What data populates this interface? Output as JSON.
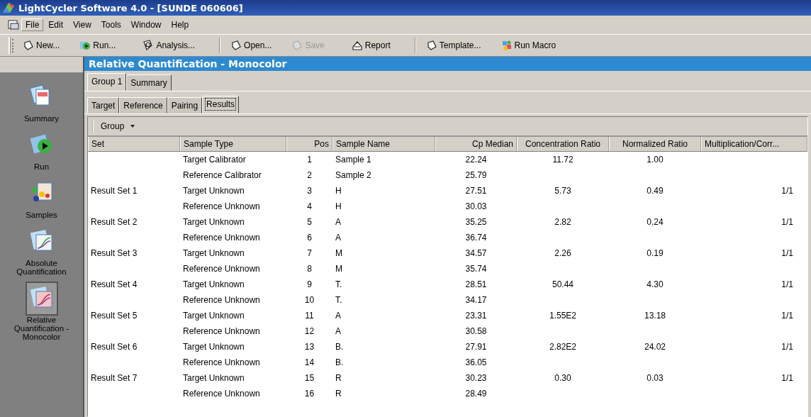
{
  "window": {
    "title": "LightCycler Software 4.0 - [SUNDE 060606]"
  },
  "menu": [
    {
      "label": "File",
      "selected": true
    },
    {
      "label": "Edit",
      "selected": false
    },
    {
      "label": "View",
      "selected": false
    },
    {
      "label": "Tools",
      "selected": false
    },
    {
      "label": "Window",
      "selected": false
    },
    {
      "label": "Help",
      "selected": false
    }
  ],
  "toolbar_groups": [
    [
      {
        "label": "New...",
        "kind": "new",
        "disabled": false
      },
      {
        "label": "Run...",
        "kind": "run",
        "disabled": false
      },
      {
        "label": "Analysis...",
        "kind": "analysis",
        "disabled": false
      }
    ],
    [
      {
        "label": "Open...",
        "kind": "open",
        "disabled": false
      },
      {
        "label": "Save",
        "kind": "save",
        "disabled": true
      },
      {
        "label": "Report",
        "kind": "report",
        "disabled": false
      }
    ],
    [
      {
        "label": "Template...",
        "kind": "template",
        "disabled": false
      },
      {
        "label": "Run Macro",
        "kind": "macro",
        "disabled": false
      }
    ]
  ],
  "sidebar": {
    "items": [
      {
        "label": "Summary",
        "kind": "summary",
        "selected": false
      },
      {
        "label": "Run",
        "kind": "run",
        "selected": false
      },
      {
        "label": "Samples",
        "kind": "samples",
        "selected": false
      },
      {
        "label": "Absolute Quantification",
        "kind": "absolute",
        "selected": false
      },
      {
        "label": "Relative Quantification - Monocolor",
        "kind": "relative",
        "selected": true
      }
    ]
  },
  "panel_title": "Relative Quantification - Monocolor",
  "group_tabs": [
    {
      "label": "Group 1",
      "selected": true
    },
    {
      "label": "Summary",
      "selected": false
    }
  ],
  "tabs": [
    {
      "label": "Target",
      "selected": false
    },
    {
      "label": "Reference",
      "selected": false
    },
    {
      "label": "Pairing",
      "selected": false
    },
    {
      "label": "Results",
      "selected": true
    }
  ],
  "grid_toolbar": {
    "label": "Group"
  },
  "table": {
    "columns": [
      "Set",
      "Sample Type",
      "Pos",
      "Sample Name",
      "Cp Median",
      "Concentration Ratio",
      "Normalized Ratio",
      "Multiplication/Corr..."
    ],
    "rows": [
      [
        "",
        "Target Calibrator",
        "1",
        "Sample 1",
        "22.24",
        "11.72",
        "1.00",
        ""
      ],
      [
        "",
        "Reference Calibrator",
        "2",
        "Sample 2",
        "25.79",
        "",
        "",
        ""
      ],
      [
        "Result Set 1",
        "Target Unknown",
        "3",
        "H",
        "27.51",
        "5.73",
        "0.49",
        "1/1"
      ],
      [
        "",
        "Reference Unknown",
        "4",
        "H",
        "30.03",
        "",
        "",
        ""
      ],
      [
        "Result Set 2",
        "Target Unknown",
        "5",
        "A",
        "35.25",
        "2.82",
        "0.24",
        "1/1"
      ],
      [
        "",
        "Reference Unknown",
        "6",
        "A",
        "36.74",
        "",
        "",
        ""
      ],
      [
        "Result Set 3",
        "Target Unknown",
        "7",
        "M",
        "34.57",
        "2.26",
        "0.19",
        "1/1"
      ],
      [
        "",
        "Reference Unknown",
        "8",
        "M",
        "35.74",
        "",
        "",
        ""
      ],
      [
        "Result Set 4",
        "Target Unknown",
        "9",
        "T.",
        "28.51",
        "50.44",
        "4.30",
        "1/1"
      ],
      [
        "",
        "Reference Unknown",
        "10",
        "T.",
        "34.17",
        "",
        "",
        ""
      ],
      [
        "Result Set 5",
        "Target Unknown",
        "11",
        "A",
        "23.31",
        "1.55E2",
        "13.18",
        "1/1"
      ],
      [
        "",
        "Reference Unknown",
        "12",
        "A",
        "30.58",
        "",
        "",
        ""
      ],
      [
        "Result Set 6",
        "Target Unknown",
        "13",
        "B.",
        "27.91",
        "2.82E2",
        "24.02",
        "1/1"
      ],
      [
        "",
        "Reference Unknown",
        "14",
        "B.",
        "36.05",
        "",
        "",
        ""
      ],
      [
        "Result Set 7",
        "Target Unknown",
        "15",
        "R",
        "30.23",
        "0.30",
        "0.03",
        "1/1"
      ],
      [
        "",
        "Reference Unknown",
        "16",
        "R",
        "28.49",
        "",
        "",
        ""
      ]
    ]
  }
}
